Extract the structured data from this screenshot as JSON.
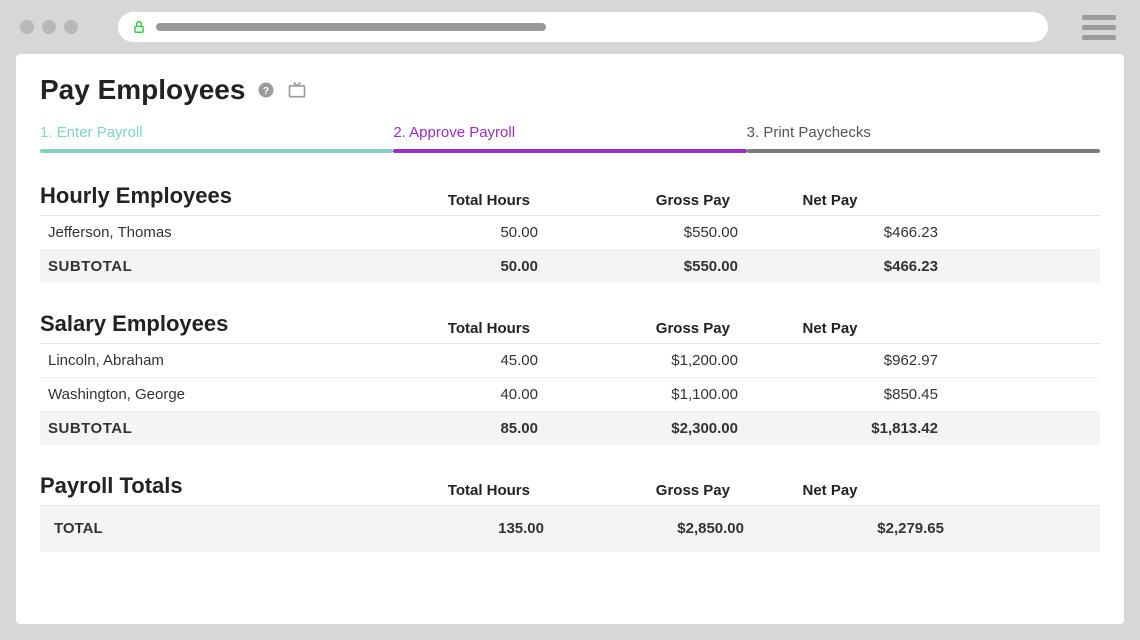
{
  "page": {
    "title": "Pay Employees"
  },
  "stepper": {
    "steps": [
      {
        "label": "1. Enter Payroll",
        "state": "completed"
      },
      {
        "label": "2. Approve Payroll",
        "state": "active"
      },
      {
        "label": "3. Print Paychecks",
        "state": "pending"
      }
    ]
  },
  "columns": {
    "total_hours": "Total Hours",
    "gross_pay": "Gross Pay",
    "net_pay": "Net Pay"
  },
  "sections": {
    "hourly": {
      "title": "Hourly Employees",
      "rows": [
        {
          "name": "Jefferson, Thomas",
          "hours": "50.00",
          "gross": "$550.00",
          "net": "$466.23"
        }
      ],
      "subtotal": {
        "label": "SUBTOTAL",
        "hours": "50.00",
        "gross": "$550.00",
        "net": "$466.23"
      }
    },
    "salary": {
      "title": "Salary Employees",
      "rows": [
        {
          "name": "Lincoln, Abraham",
          "hours": "45.00",
          "gross": "$1,200.00",
          "net": "$962.97"
        },
        {
          "name": "Washington, George",
          "hours": "40.00",
          "gross": "$1,100.00",
          "net": "$850.45"
        }
      ],
      "subtotal": {
        "label": "SUBTOTAL",
        "hours": "85.00",
        "gross": "$2,300.00",
        "net": "$1,813.42"
      }
    },
    "totals": {
      "title": "Payroll Totals",
      "total": {
        "label": "TOTAL",
        "hours": "135.00",
        "gross": "$2,850.00",
        "net": "$2,279.65"
      }
    }
  }
}
